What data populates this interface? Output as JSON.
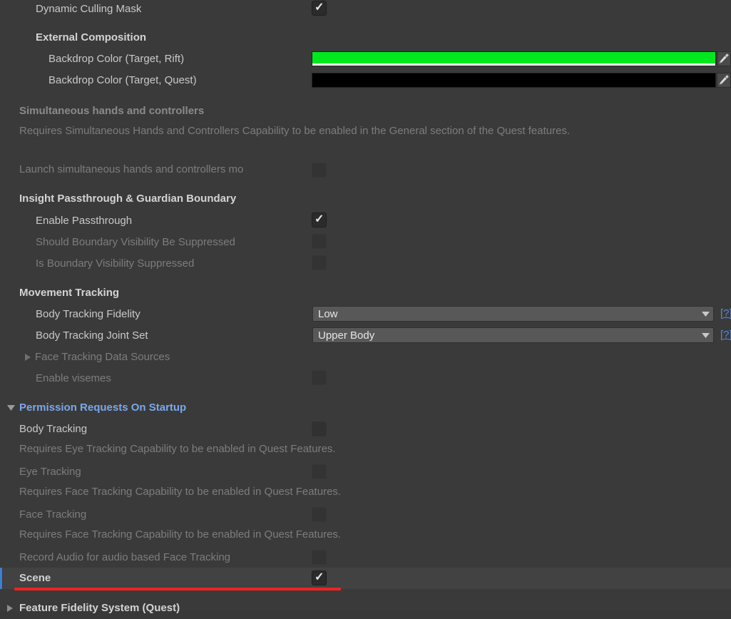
{
  "panel": {
    "background": "#3a3a3a",
    "accent_blue": "#7ba7ec",
    "link_blue": "#5a87d6",
    "highlight_red": "#f02222",
    "selection_bar": "#3d7fd4"
  },
  "rows": {
    "dynamic_culling_mask": {
      "label": "Dynamic Culling Mask",
      "checked": true
    },
    "external_composition_header": {
      "label": "External Composition"
    },
    "backdrop_rift": {
      "label": "Backdrop Color (Target, Rift)",
      "color": "#00e81e",
      "alpha_color": "#ffffff"
    },
    "backdrop_quest": {
      "label": "Backdrop Color (Target, Quest)",
      "color": "#000000",
      "alpha_color": "#000000"
    },
    "simultaneous_header": {
      "label": "Simultaneous hands and controllers"
    },
    "simultaneous_help": "Requires Simultaneous Hands and Controllers Capability to be enabled in the General section of the Quest features.",
    "launch_simultaneous": {
      "label": "Launch simultaneous hands and controllers mo",
      "checked": false
    },
    "insight_header": {
      "label": "Insight Passthrough & Guardian Boundary"
    },
    "enable_passthrough": {
      "label": "Enable Passthrough",
      "checked": true
    },
    "should_boundary_suppressed": {
      "label": "Should Boundary Visibility Be Suppressed",
      "checked": false
    },
    "is_boundary_suppressed": {
      "label": "Is Boundary Visibility Suppressed",
      "checked": false
    },
    "movement_header": {
      "label": "Movement Tracking"
    },
    "body_tracking_fidelity": {
      "label": "Body Tracking Fidelity",
      "value": "Low",
      "help": "[?]"
    },
    "body_tracking_joint_set": {
      "label": "Body Tracking Joint Set",
      "value": "Upper Body",
      "help": "[?]"
    },
    "face_tracking_data_sources": {
      "label": "Face Tracking Data Sources",
      "expanded": false
    },
    "enable_visemes": {
      "label": "Enable visemes",
      "checked": false
    },
    "permission_requests_header": {
      "label": "Permission Requests On Startup",
      "expanded": true
    },
    "perm_body_tracking": {
      "label": "Body Tracking",
      "checked": false
    },
    "perm_eye_help": "Requires Eye Tracking Capability to be enabled in Quest Features.",
    "perm_eye_tracking": {
      "label": "Eye Tracking",
      "checked": false
    },
    "perm_face_help_1": "Requires Face Tracking Capability to be enabled in Quest Features.",
    "perm_face_tracking": {
      "label": "Face Tracking",
      "checked": false
    },
    "perm_face_help_2": "Requires Face Tracking Capability to be enabled in Quest Features.",
    "perm_record_audio": {
      "label": "Record Audio for audio based Face Tracking",
      "checked": false
    },
    "perm_scene": {
      "label": "Scene",
      "checked": true,
      "selected": true
    },
    "feature_fidelity_header": {
      "label": "Feature Fidelity System (Quest)",
      "expanded": false
    }
  }
}
